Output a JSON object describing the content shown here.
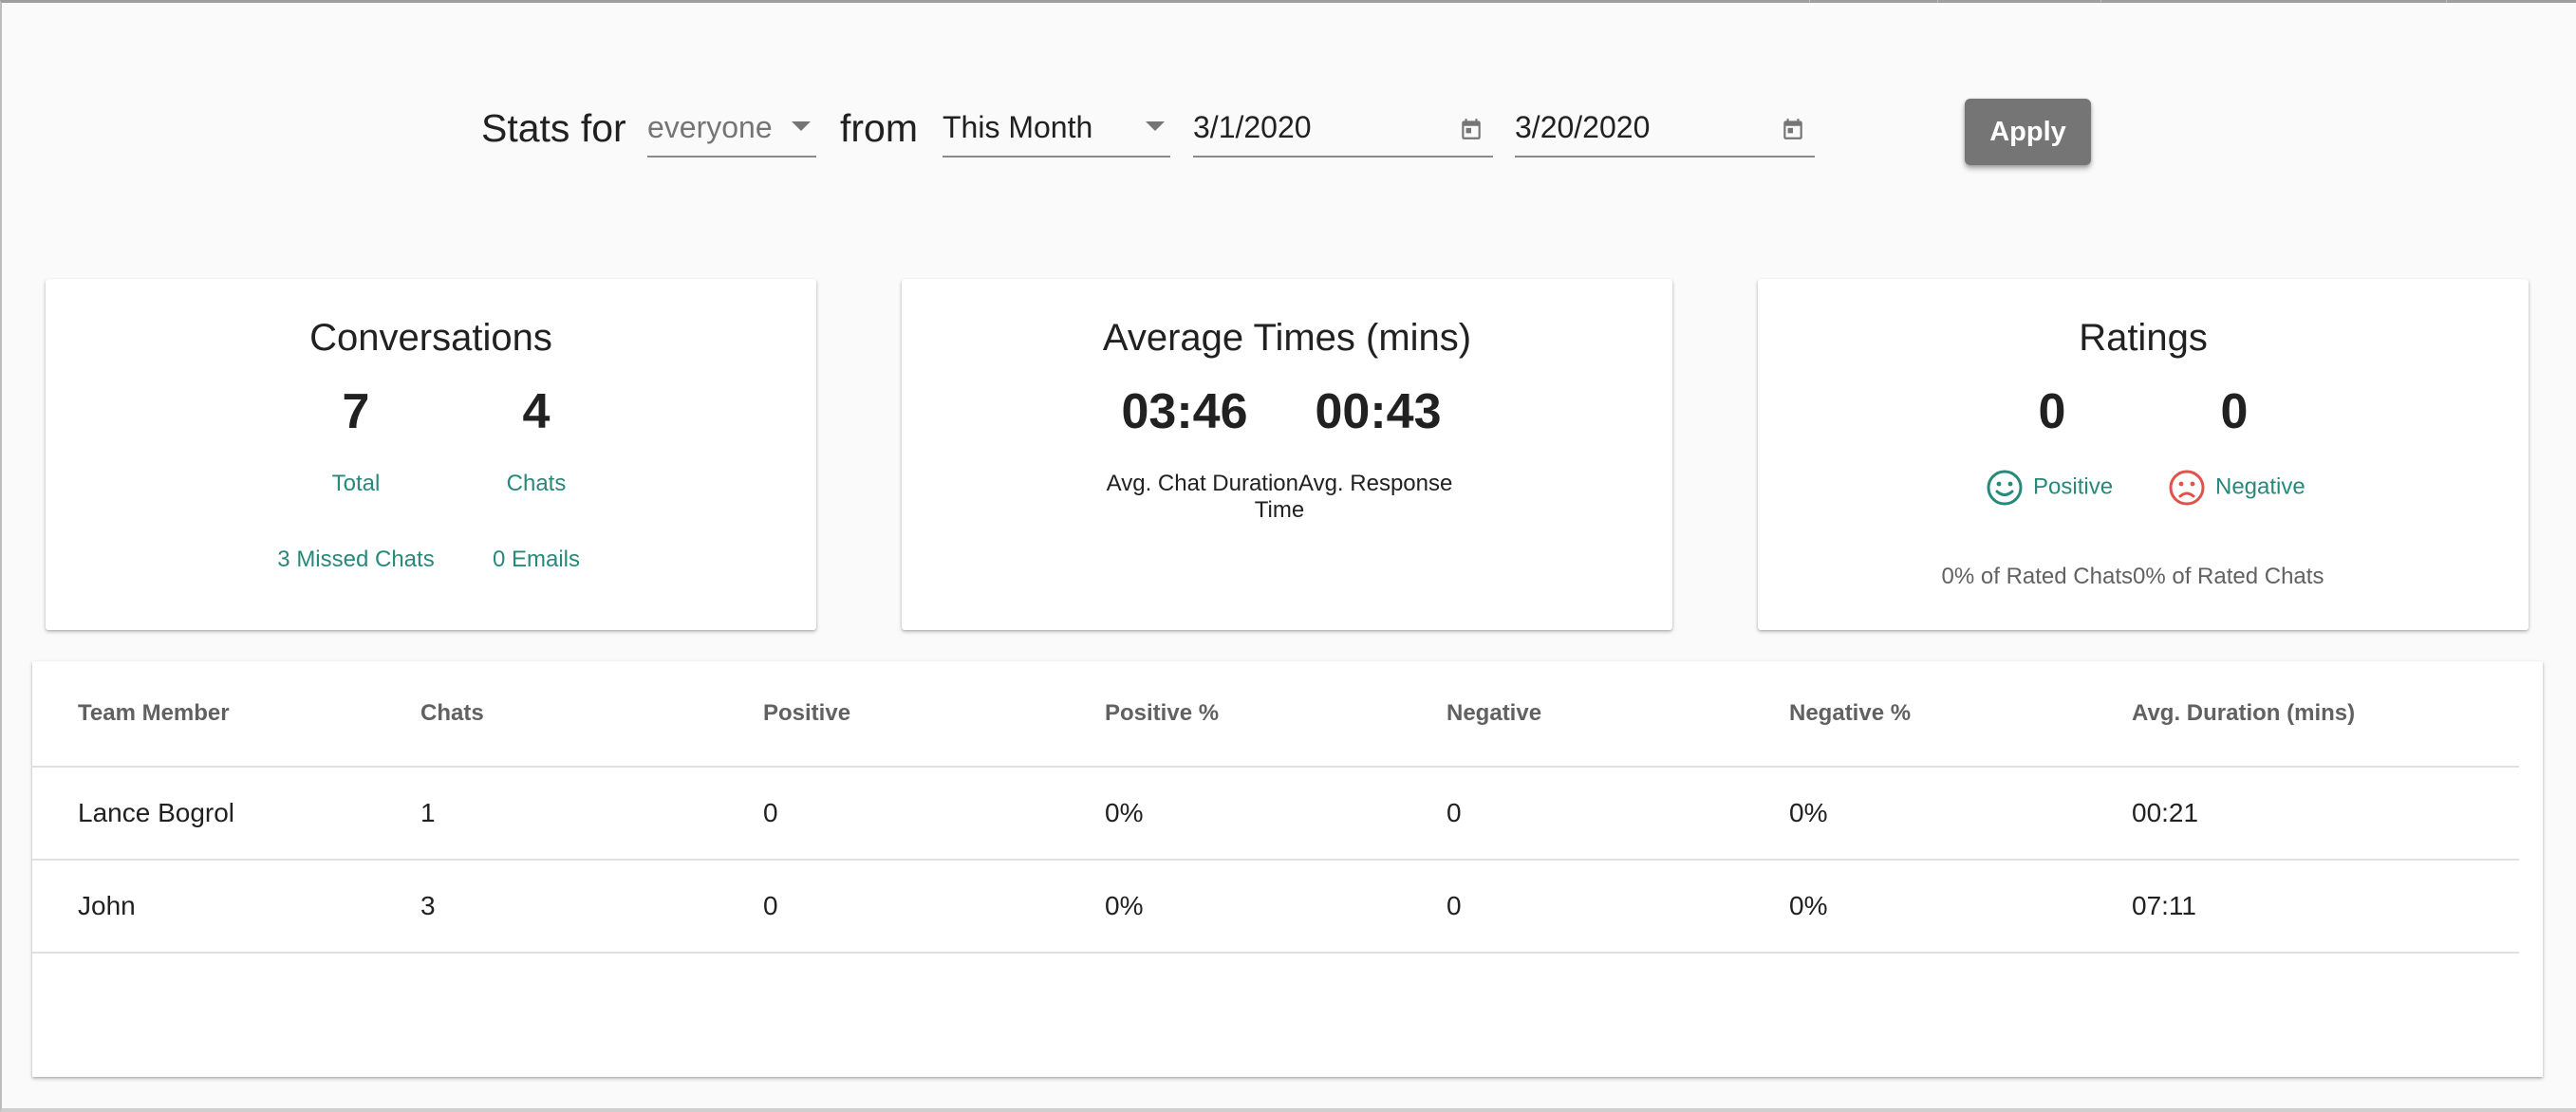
{
  "filters": {
    "stats_for_label": "Stats for",
    "who_value": "everyone",
    "from_label": "from",
    "period_value": "This Month",
    "start_date": "3/1/2020",
    "end_date": "3/20/2020",
    "apply_label": "Apply"
  },
  "cards": {
    "conversations": {
      "title": "Conversations",
      "total_value": "7",
      "total_label": "Total",
      "chats_value": "4",
      "chats_label": "Chats",
      "missed_label": "3 Missed Chats",
      "emails_label": "0 Emails"
    },
    "average_times": {
      "title": "Average Times (mins)",
      "chat_duration_value": "03:46",
      "chat_duration_label": "Avg. Chat Duration",
      "response_time_value": "00:43",
      "response_time_label": "Avg. Response Time"
    },
    "ratings": {
      "title": "Ratings",
      "positive_value": "0",
      "positive_label": "Positive",
      "positive_sub": "0% of Rated Chats",
      "negative_value": "0",
      "negative_label": "Negative",
      "negative_sub": "0% of Rated Chats"
    }
  },
  "table": {
    "columns": [
      "Team Member",
      "Chats",
      "Positive",
      "Positive %",
      "Negative",
      "Negative %",
      "Avg. Duration (mins)"
    ],
    "rows": [
      [
        "Lance Bogrol",
        "1",
        "0",
        "0%",
        "0",
        "0%",
        "00:21"
      ],
      [
        "John",
        "3",
        "0",
        "0%",
        "0",
        "0%",
        "07:11"
      ]
    ]
  },
  "colors": {
    "accent_teal": "#26897a",
    "negative_red": "#e0524a",
    "button_grey": "#757575"
  }
}
